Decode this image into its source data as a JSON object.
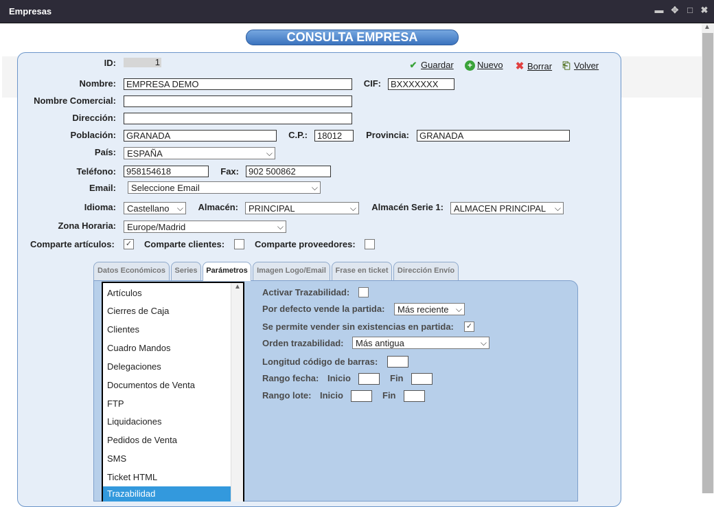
{
  "window": {
    "title": "Empresas",
    "controls": [
      "minimize-icon",
      "move-icon",
      "maximize-icon",
      "close-icon"
    ]
  },
  "banner": "CONSULTA EMPRESA",
  "actions": {
    "save": "Guardar",
    "new": "Nuevo",
    "delete": "Borrar",
    "back": "Volver"
  },
  "form": {
    "id_label": "ID:",
    "id_value": "1",
    "nombre_label": "Nombre:",
    "nombre_value": "EMPRESA DEMO",
    "cif_label": "CIF:",
    "cif_value": "BXXXXXXX",
    "nombre_comercial_label": "Nombre Comercial:",
    "nombre_comercial_value": "",
    "direccion_label": "Dirección:",
    "direccion_value": "",
    "poblacion_label": "Población:",
    "poblacion_value": "GRANADA",
    "cp_label": "C.P.:",
    "cp_value": "18012",
    "provincia_label": "Provincia:",
    "provincia_value": "GRANADA",
    "pais_label": "País:",
    "pais_value": "ESPAÑA",
    "telefono_label": "Teléfono:",
    "telefono_value": "958154618",
    "fax_label": "Fax:",
    "fax_value": "902 500862",
    "email_label": "Email:",
    "email_value": "Seleccione Email",
    "idioma_label": "Idioma:",
    "idioma_value": "Castellano",
    "almacen_label": "Almacén:",
    "almacen_value": "PRINCIPAL",
    "almacen_serie_label": "Almacén Serie 1:",
    "almacen_serie_value": "ALMACEN PRINCIPAL",
    "zona_label": "Zona Horaria:",
    "zona_value": "Europe/Madrid",
    "comparte_articulos_label": "Comparte artículos:",
    "comparte_articulos": true,
    "comparte_clientes_label": "Comparte clientes:",
    "comparte_clientes": false,
    "comparte_proveedores_label": "Comparte proveedores:",
    "comparte_proveedores": false
  },
  "tabs": [
    "Datos Económicos",
    "Series",
    "Parámetros",
    "Imagen Logo/Email",
    "Frase en ticket",
    "Dirección Envío"
  ],
  "active_tab": "Parámetros",
  "param_list": [
    "Artículos",
    "Cierres de Caja",
    "Clientes",
    "Cuadro Mandos",
    "Delegaciones",
    "Documentos de Venta",
    "FTP",
    "Liquidaciones",
    "Pedidos de Venta",
    "SMS",
    "Ticket HTML"
  ],
  "param_list_selected": "Trazabilidad",
  "params": {
    "activar_label": "Activar Trazabilidad:",
    "activar": false,
    "vende_label": "Por defecto vende la partida:",
    "vende_value": "Más reciente",
    "sin_existencias_label": "Se permite vender sin existencias en partida:",
    "sin_existencias": true,
    "orden_label": "Orden trazabilidad:",
    "orden_value": "Más antigua",
    "longitud_label": "Longitud código de barras:",
    "rango_fecha_label": "Rango fecha:",
    "rango_lote_label": "Rango lote:",
    "inicio_label": "Inicio",
    "fin_label": "Fin"
  },
  "colors": {
    "titlebar": "#2d2b38",
    "panel": "#e6eef8",
    "tabpanel": "#b7cfea",
    "banner": "#3b73be",
    "selection": "#3399dd"
  }
}
